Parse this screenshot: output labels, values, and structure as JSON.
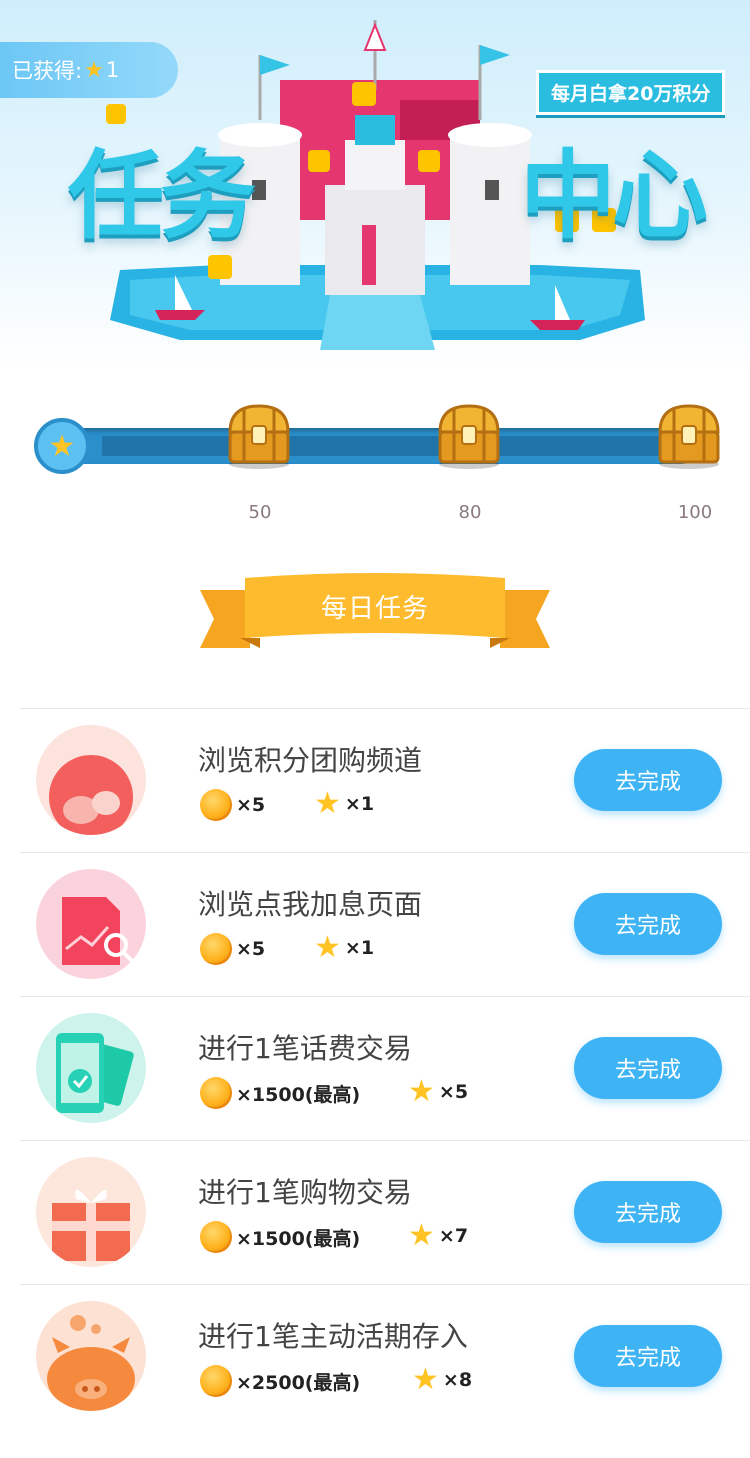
{
  "header": {
    "earned_label": "已获得:",
    "earned_count": "1",
    "title_left": "任务",
    "title_right": "中心",
    "monthly_tag": "每月白拿20万积分"
  },
  "progress": {
    "current_stars": 1,
    "milestones": [
      {
        "label": "50",
        "value": 50
      },
      {
        "label": "80",
        "value": 80
      },
      {
        "label": "100",
        "value": 100
      }
    ]
  },
  "section": {
    "title": "每日任务"
  },
  "tasks": [
    {
      "title": "浏览积分团购频道",
      "coin": "×5",
      "star": "×1",
      "button": "去完成",
      "icon": "shopping-icon",
      "color": "#fde3dd"
    },
    {
      "title": "浏览点我加息页面",
      "coin": "×5",
      "star": "×1",
      "button": "去完成",
      "icon": "document-chart-icon",
      "color": "#fbd3dc"
    },
    {
      "title": "进行1笔话费交易",
      "coin": "×1500(最高)",
      "star": "×5",
      "button": "去完成",
      "icon": "phone-check-icon",
      "color": "#cdf3ec"
    },
    {
      "title": "进行1笔购物交易",
      "coin": "×1500(最高)",
      "star": "×7",
      "button": "去完成",
      "icon": "gift-icon",
      "color": "#fde7dc"
    },
    {
      "title": "进行1笔主动活期存入",
      "coin": "×2500(最高)",
      "star": "×8",
      "button": "去完成",
      "icon": "piggy-bank-icon",
      "color": "#fde2d4"
    }
  ],
  "colors": {
    "accent": "#3fb4f5",
    "track": "#2a8fcb",
    "coin": "#ffb11e",
    "star": "#ffc323"
  }
}
